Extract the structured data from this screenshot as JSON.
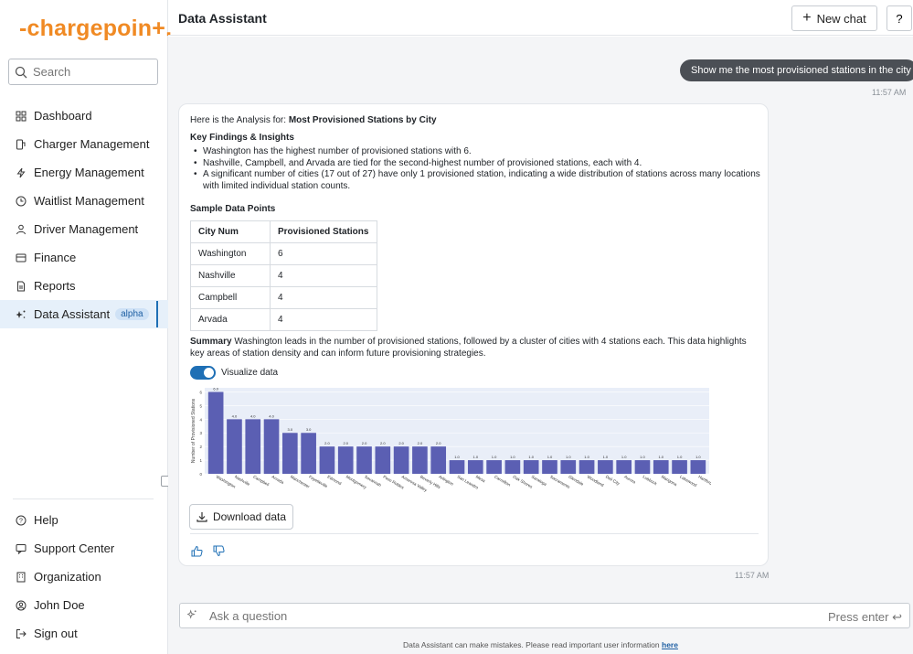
{
  "sidebar": {
    "logo": "-chargepoin+.",
    "search_placeholder": "Search",
    "items": [
      {
        "label": "Dashboard",
        "icon": "dashboard-icon"
      },
      {
        "label": "Charger Management",
        "icon": "charger-icon"
      },
      {
        "label": "Energy Management",
        "icon": "lightning-icon"
      },
      {
        "label": "Waitlist Management",
        "icon": "clock-icon"
      },
      {
        "label": "Driver Management",
        "icon": "driver-icon"
      },
      {
        "label": "Finance",
        "icon": "finance-icon"
      },
      {
        "label": "Reports",
        "icon": "report-icon"
      },
      {
        "label": "Data Assistant",
        "icon": "sparkle-icon",
        "badge": "alpha",
        "active": true
      }
    ],
    "bottom_items": [
      {
        "label": "Help",
        "icon": "help-icon"
      },
      {
        "label": "Support Center",
        "icon": "support-icon"
      },
      {
        "label": "Organization",
        "icon": "building-icon"
      },
      {
        "label": "John Doe",
        "icon": "user-icon"
      },
      {
        "label": "Sign out",
        "icon": "signout-icon"
      }
    ]
  },
  "header": {
    "title": "Data Assistant",
    "new_chat": "New chat",
    "help": "?"
  },
  "chat": {
    "user_message": "Show me the most provisioned stations in the city",
    "user_time": "11:57 AM",
    "response": {
      "intro_prefix": "Here is the Analysis for:",
      "intro_bold": "Most Provisioned Stations by City",
      "findings_title": "Key Findings & Insights",
      "bullets": [
        "Washington has the highest number of provisioned stations with 6.",
        "Nashville, Campbell, and Arvada are tied for the second-highest number of provisioned stations, each with 4.",
        "A significant number of cities (17 out of 27) have only 1 provisioned station, indicating a wide distribution of stations across many locations with limited individual station counts."
      ],
      "sample_title": "Sample Data Points",
      "table": {
        "headers": [
          "City Num",
          "Provisioned Stations"
        ],
        "rows": [
          [
            "Washington",
            "6"
          ],
          [
            "Nashville",
            "4"
          ],
          [
            "Campbell",
            "4"
          ],
          [
            "Arvada",
            "4"
          ]
        ]
      },
      "summary_label": "Summary",
      "summary_text": "Washington leads in the number of provisioned stations, followed by a cluster of cities with 4 stations each. This data highlights key areas of station density and can inform future provisioning strategies.",
      "toggle_label": "Visualize data",
      "download_label": "Download data",
      "time": "11:57 AM"
    }
  },
  "chart_data": {
    "type": "bar",
    "ylabel": "Number of Provisioned Stations",
    "categories": [
      "Washington",
      "Nashville",
      "Campbell",
      "Arvada",
      "Manchester",
      "Fayetteville",
      "Edmond",
      "Montgomery",
      "Savannah",
      "Paso Robles",
      "Amarosa Valley",
      "Beverly Hills",
      "Arlington",
      "San Leandro",
      "Mesa",
      "Carrollton",
      "Oak Shores",
      "Saratoga",
      "Sacramento",
      "Glendale",
      "Woodland",
      "Deli City",
      "Aurora",
      "Lubbock",
      "Marigona",
      "Lakewood",
      "Hartford"
    ],
    "values": [
      6,
      4,
      4,
      4,
      3,
      3,
      2,
      2,
      2,
      2,
      2,
      2,
      2,
      1,
      1,
      1,
      1,
      1,
      1,
      1,
      1,
      1,
      1,
      1,
      1,
      1,
      1
    ],
    "data_labels": [
      "6.0",
      "4.0",
      "4.0",
      "4.0",
      "3.0",
      "3.0",
      "2.0",
      "2.0",
      "2.0",
      "2.0",
      "2.0",
      "2.0",
      "2.0",
      "1.0",
      "1.0",
      "1.0",
      "1.0",
      "1.0",
      "1.0",
      "1.0",
      "1.0",
      "1.0",
      "1.0",
      "1.0",
      "1.0",
      "1.0",
      "1.0"
    ],
    "yticks": [
      "0",
      "1",
      "2",
      "3",
      "4",
      "5",
      "6"
    ],
    "ylim": [
      0,
      6.3
    ],
    "bar_color": "#5b5fb3",
    "background": "#e9eef8",
    "grid": true
  },
  "input": {
    "placeholder": "Ask a question",
    "hint": "Press enter ↩"
  },
  "disclaimer": {
    "text": "Data Assistant can make mistakes. Please read important user information",
    "link": "here"
  },
  "colors": {
    "brand": "#f08a24",
    "accent": "#1e6fb5",
    "bar": "#5b5fb3"
  }
}
